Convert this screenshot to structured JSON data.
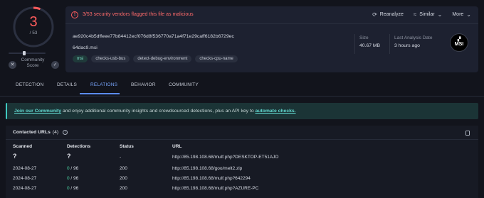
{
  "detection": {
    "score": "3",
    "total": "/ 53",
    "community_score_label": "Community Score",
    "vote_down_icon": "x-icon",
    "vote_up_icon": "check-icon"
  },
  "header": {
    "alert": "3/53 security vendors flagged this file as malicious",
    "actions": [
      {
        "label": "Reanalyze",
        "icon": "refresh-icon"
      },
      {
        "label": "Similar",
        "icon": "similar-icon"
      },
      {
        "label": "More",
        "icon": "chevron-down-icon"
      }
    ],
    "hash": "ae920c4b5dffeee77b84412ecf076d8f536770a71a4f71e29caff6182b6729ec",
    "filename": "64dac9.msi",
    "tags": [
      "msi",
      "checks-usb-bus",
      "detect-debug-environment",
      "checks-cpu-name"
    ],
    "size_label": "Size",
    "size_value": "40.67 MB",
    "date_label": "Last Analysis Date",
    "date_value": "3 hours ago",
    "filetype": "MSI"
  },
  "tabs": [
    "DETECTION",
    "DETAILS",
    "RELATIONS",
    "BEHAVIOR",
    "COMMUNITY"
  ],
  "active_tab": "RELATIONS",
  "banner": {
    "link1": "Join our Community",
    "text": " and enjoy additional community insights and crowdsourced detections, plus an API key to ",
    "link2": "automate checks."
  },
  "contacted_urls": {
    "title": "Contacted URLs",
    "count": "(4)",
    "columns": [
      "Scanned",
      "Detections",
      "Status",
      "URL"
    ],
    "rows": [
      {
        "scanned": "?",
        "det_pos": "",
        "det_total": "?",
        "status": "-",
        "url": "http://85.198.108.68/mulf.php?DESKTOP-ET51AJO"
      },
      {
        "scanned": "2024-08-27",
        "det_pos": "0",
        "det_total": " / 96",
        "status": "200",
        "url": "http://85.198.108.68/goo/melt2.zip"
      },
      {
        "scanned": "2024-08-27",
        "det_pos": "0",
        "det_total": " / 96",
        "status": "200",
        "url": "http://85.198.108.68/mulf.php?642294"
      },
      {
        "scanned": "2024-08-27",
        "det_pos": "0",
        "det_total": " / 96",
        "status": "200",
        "url": "http://85.198.108.68/mulf.php?AZURE-PC"
      }
    ]
  },
  "colors": {
    "malicious": "#ff5c5c",
    "accent": "#5b8cff",
    "clean": "#4ad1a0",
    "banner_link": "#62d7cf"
  }
}
